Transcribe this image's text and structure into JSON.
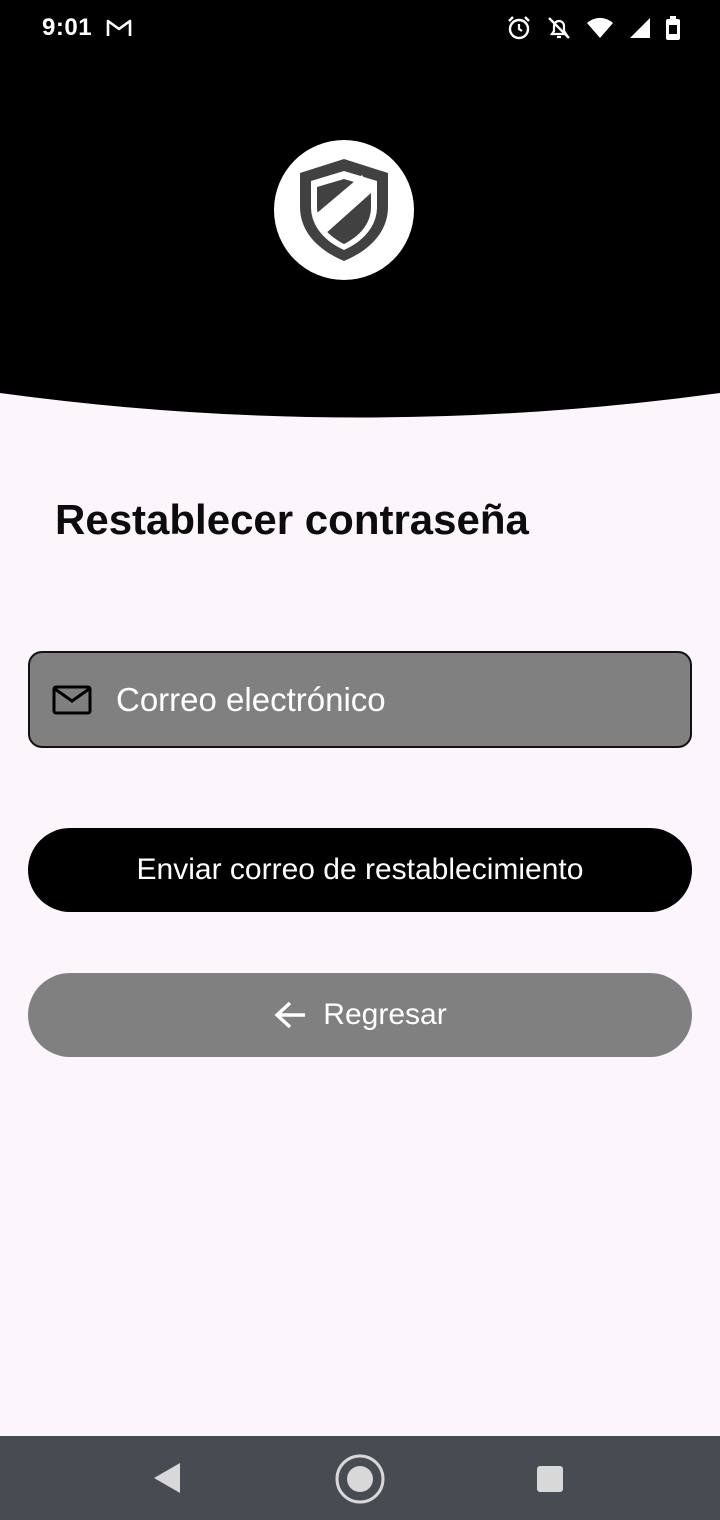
{
  "status_bar": {
    "time": "9:01",
    "left_icons": [
      "gmail-icon"
    ],
    "right_icons": [
      "alarm-icon",
      "bell-off-icon",
      "wifi-icon",
      "signal-icon",
      "battery-icon"
    ]
  },
  "header": {
    "logo_icon": "shield-icon",
    "background_color": "#000000"
  },
  "form": {
    "title": "Restablecer contraseña",
    "email": {
      "icon": "mail-icon",
      "placeholder": "Correo electrónico",
      "value": ""
    },
    "send_button": {
      "label": "Enviar correo de restablecimiento"
    },
    "back_button": {
      "icon": "arrow-left-icon",
      "label": "Regresar"
    }
  },
  "nav_bar": {
    "buttons": [
      "back",
      "home",
      "recents"
    ]
  },
  "colors": {
    "background": "#fcf5fc",
    "header": "#000000",
    "field": "#808080",
    "primary_button": "#000000",
    "secondary_button": "#808080",
    "nav_bar": "#474c52"
  }
}
